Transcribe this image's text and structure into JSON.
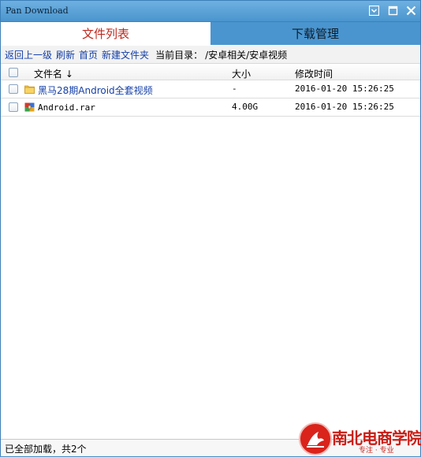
{
  "window": {
    "title": "Pan Download",
    "min_label": "▾",
    "max_label": "□",
    "close_label": "✕"
  },
  "tabs": [
    {
      "label": "文件列表",
      "active": true
    },
    {
      "label": "下载管理",
      "active": false
    }
  ],
  "toolbar": {
    "back": "返回上一级",
    "refresh": "刷新",
    "home": "首页",
    "new_folder": "新建文件夹",
    "current_dir_label": "当前目录：",
    "current_dir": "/安卓相关/安卓视频"
  },
  "columns": {
    "name": "文件名 ↓",
    "size": "大小",
    "modified": "修改时间"
  },
  "files": [
    {
      "name": "黑马28期Android全套视频",
      "size": "-",
      "modified": "2016-01-20 15:26:25",
      "type": "folder-icon"
    },
    {
      "name": "Android.rar",
      "size": "4.00G",
      "modified": "2016-01-20 15:26:25",
      "type": "archive-icon"
    }
  ],
  "status": {
    "text": "已全部加载，共2个"
  },
  "watermark": {
    "name": "南北电商学院",
    "sub": "专注 · 专业"
  },
  "colors": {
    "titlebar": "#4a95cf",
    "active_tab_text": "#c0281d",
    "link": "#1540a8",
    "watermark": "#c91e16"
  }
}
